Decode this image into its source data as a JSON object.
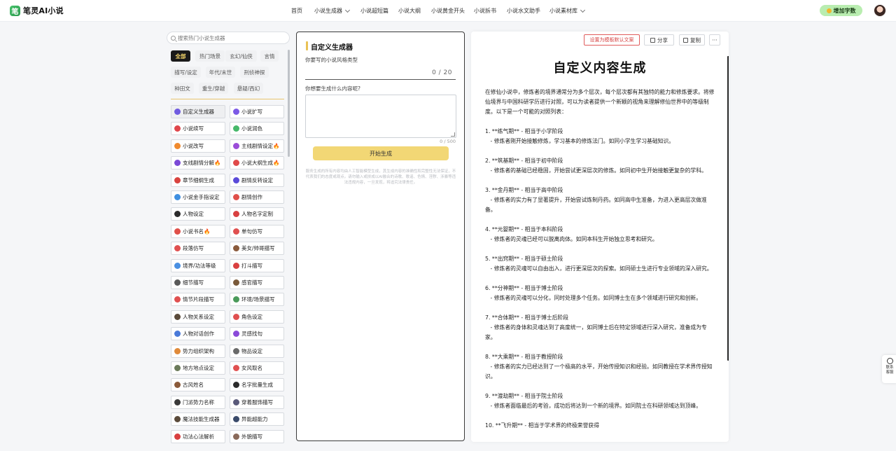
{
  "app": {
    "logo_text": "笔灵AI小说",
    "logo_glyph": "笔"
  },
  "nav": {
    "items": [
      {
        "label": "首页",
        "has_dropdown": false
      },
      {
        "label": "小说生成器",
        "has_dropdown": true
      },
      {
        "label": "小说超短篇",
        "has_dropdown": false
      },
      {
        "label": "小说大纲",
        "has_dropdown": false
      },
      {
        "label": "小说黄金开头",
        "has_dropdown": false
      },
      {
        "label": "小说拆书",
        "has_dropdown": false
      },
      {
        "label": "小说水文助手",
        "has_dropdown": false
      },
      {
        "label": "小说素材库",
        "has_dropdown": true
      }
    ],
    "add_words_label": "增加字数"
  },
  "sidebar": {
    "search_placeholder": "搜索热门小说生成器",
    "categories": [
      {
        "label": "全部",
        "active": true
      },
      {
        "label": "热门场景",
        "active": false
      },
      {
        "label": "玄幻/仙侠",
        "active": false
      },
      {
        "label": "言情",
        "active": false
      },
      {
        "label": "描写/设定",
        "active": false
      },
      {
        "label": "年代/末世",
        "active": false
      },
      {
        "label": "刑侦神探",
        "active": false
      },
      {
        "label": "种田文",
        "active": false
      },
      {
        "label": "重生/穿越",
        "active": false
      },
      {
        "label": "悬疑/西幻",
        "active": false
      }
    ],
    "tools": [
      {
        "label": "自定义生成器",
        "icon": "custom-icon",
        "color": "#6f5be0",
        "selected": true
      },
      {
        "label": "小说扩写",
        "icon": "expand-icon",
        "color": "#7c5ae6",
        "selected": false
      },
      {
        "label": "小说续写",
        "icon": "continue-icon",
        "color": "#e0474c",
        "selected": false
      },
      {
        "label": "小说润色",
        "icon": "polish-icon",
        "color": "#46b86a",
        "selected": false
      },
      {
        "label": "小说改写",
        "icon": "rewrite-icon",
        "color": "#f08a2e",
        "selected": false
      },
      {
        "label": "主线剧情设定🔥",
        "icon": "mainline-icon",
        "color": "#9b4dd8",
        "selected": false
      },
      {
        "label": "支线剧情分解🔥",
        "icon": "subplot-icon",
        "color": "#7b49d6",
        "selected": false
      },
      {
        "label": "小说大纲生成🔥",
        "icon": "outline-icon",
        "color": "#e04a4a",
        "selected": false
      },
      {
        "label": "章节细纲生成",
        "icon": "chapter-icon",
        "color": "#d9433f",
        "selected": false
      },
      {
        "label": "剧情反转设定",
        "icon": "twist-icon",
        "color": "#5a4ad9",
        "selected": false
      },
      {
        "label": "小说金手指设定",
        "icon": "goldfinger-icon",
        "color": "#3f8fe0",
        "selected": false
      },
      {
        "label": "剧情创作",
        "icon": "plot-icon",
        "color": "#e0504a",
        "selected": false
      },
      {
        "label": "人物设定",
        "icon": "character-icon",
        "color": "#2b2b2b",
        "selected": false
      },
      {
        "label": "人物名字定制",
        "icon": "name-icon",
        "color": "#d84040",
        "selected": false
      },
      {
        "label": "小说书名🔥",
        "icon": "title-icon",
        "color": "#e0504a",
        "selected": false
      },
      {
        "label": "单句仿写",
        "icon": "sentence-icon",
        "color": "#e05050",
        "selected": false
      },
      {
        "label": "段落仿写",
        "icon": "paragraph-icon",
        "color": "#e05050",
        "selected": false
      },
      {
        "label": "美女/帅哥描写",
        "icon": "beauty-icon",
        "color": "#8a5a3c",
        "selected": false
      },
      {
        "label": "境界/功法等级",
        "icon": "realm-icon",
        "color": "#4a90e2",
        "selected": false
      },
      {
        "label": "打斗描写",
        "icon": "fight-icon",
        "color": "#d94040",
        "selected": false
      },
      {
        "label": "细节描写",
        "icon": "detail-icon",
        "color": "#5a5a5a",
        "selected": false
      },
      {
        "label": "感官描写",
        "icon": "sense-icon",
        "color": "#7a5a3a",
        "selected": false
      },
      {
        "label": "情节片段描写",
        "icon": "fragment-icon",
        "color": "#e05050",
        "selected": false
      },
      {
        "label": "环境/场景描写",
        "icon": "scene-icon",
        "color": "#4a9a5a",
        "selected": false
      },
      {
        "label": "人物关系设定",
        "icon": "relation-icon",
        "color": "#5a4a3a",
        "selected": false
      },
      {
        "label": "角色设定",
        "icon": "role-icon",
        "color": "#e05050",
        "selected": false
      },
      {
        "label": "人物对话创作",
        "icon": "dialog-icon",
        "color": "#4a7ad9",
        "selected": false
      },
      {
        "label": "灵感找句",
        "icon": "inspire-icon",
        "color": "#8a4ad9",
        "selected": false
      },
      {
        "label": "势力组织架构",
        "icon": "faction-icon",
        "color": "#e08a3a",
        "selected": false
      },
      {
        "label": "物品设定",
        "icon": "item-icon",
        "color": "#6a6a6a",
        "selected": false
      },
      {
        "label": "地方地点设定",
        "icon": "place-icon",
        "color": "#6a7a5a",
        "selected": false
      },
      {
        "label": "女风取名",
        "icon": "female-name-icon",
        "color": "#e05050",
        "selected": false
      },
      {
        "label": "古风姓名",
        "icon": "ancient-name-icon",
        "color": "#8a5a3a",
        "selected": false
      },
      {
        "label": "名字批量生成",
        "icon": "batch-name-icon",
        "color": "#2b2b2b",
        "selected": false
      },
      {
        "label": "门派势力名称",
        "icon": "sect-icon",
        "color": "#3a3a3a",
        "selected": false
      },
      {
        "label": "穿着服饰描写",
        "icon": "clothing-icon",
        "color": "#5a5a7a",
        "selected": false
      },
      {
        "label": "魔法技能生成器",
        "icon": "magic-icon",
        "color": "#5a4a3a",
        "selected": false
      },
      {
        "label": "异能超能力",
        "icon": "power-icon",
        "color": "#3a4a6a",
        "selected": false
      },
      {
        "label": "功法心法解析",
        "icon": "method-icon",
        "color": "#d94040",
        "selected": false
      },
      {
        "label": "外貌描写",
        "icon": "looks-icon",
        "color": "#8a6a5a",
        "selected": false
      }
    ]
  },
  "generator": {
    "title": "自定义生成器",
    "q1_label": "你要写的小说风格类型",
    "q1_value": "",
    "q1_count": "0 / 20",
    "q2_label": "你想要生成什么内容呢?",
    "q2_value": "",
    "q2_count": "0 / 500",
    "submit_label": "开始生成",
    "disclaimer": "服务生成的所有内容均由人工智能模型生成，其生成内容的准确性和完整性无法保证，不代表我们的态度或观点。请勿输入或拼成以AI融合的诗歌、歌谣、色情、淫秽、涉暴等违法违规内容，一旦发现，将追究法律责任。"
  },
  "output": {
    "set_default_label": "设置为模板默认文案",
    "share_label": "分享",
    "copy_label": "复制",
    "more_label": "···",
    "title": "自定义内容生成",
    "intro": "在修仙小说中，修炼者的境界通常分为多个层次，每个层次都有其独特的能力和修炼要求。将修仙境界与中国科研学历进行对照，可以为读者提供一个新颖的视角来理解修仙世界中的等级制度。以下是一个可能的对照列表：",
    "items": [
      {
        "heading": "1. **练气期** - 相当于小学阶段",
        "detail": "   - 修炼者刚开始接触修炼，学习基本的修炼法门。如同小学生学习基础知识。"
      },
      {
        "heading": "2. **筑基期** - 相当于初中阶段",
        "detail": "   - 修炼者的基础已经稳固，开始尝试更深层次的修炼。如同初中生开始接触更复杂的学科。"
      },
      {
        "heading": "3. **金丹期** - 相当于高中阶段",
        "detail": "   - 修炼者的实力有了显著提升，开始尝试炼制丹药。如同高中生准备，为进入更高层次做准备。"
      },
      {
        "heading": "4. **元婴期** - 相当于本科阶段",
        "detail": "   - 修炼者的灵魂已经可以脱离肉体。如同本科生开始独立思考和研究。"
      },
      {
        "heading": "5. **出窍期** - 相当于硕士阶段",
        "detail": "   - 修炼者的灵魂可以自由出入，进行更深层次的探索。如同硕士生进行专业领域的深入研究。"
      },
      {
        "heading": "6. **分神期** - 相当于博士阶段",
        "detail": "   - 修炼者的灵魂可以分化，同时处理多个任务。如同博士生在多个领域进行研究和创新。"
      },
      {
        "heading": "7. **合体期** - 相当于博士后阶段",
        "detail": "   - 修炼者的身体和灵魂达到了高度统一，如同博士后在特定领域进行深入研究，准备成为专家。"
      },
      {
        "heading": "8. **大乘期** - 相当于教授阶段",
        "detail": "   - 修炼者的实力已经达到了一个极高的水平，开始传授知识和经验。如同教授在学术界传授知识。"
      },
      {
        "heading": "9. **渡劫期** - 相当于院士阶段",
        "detail": "   - 修炼者面临最后的考验，成功后将达到一个新的境界。如同院士在科研领域达到顶峰。"
      },
      {
        "heading": "10. **飞升期** - 相当于学术界的终极荣誉获得",
        "detail": ""
      }
    ]
  },
  "service": {
    "label": "联系客服"
  }
}
